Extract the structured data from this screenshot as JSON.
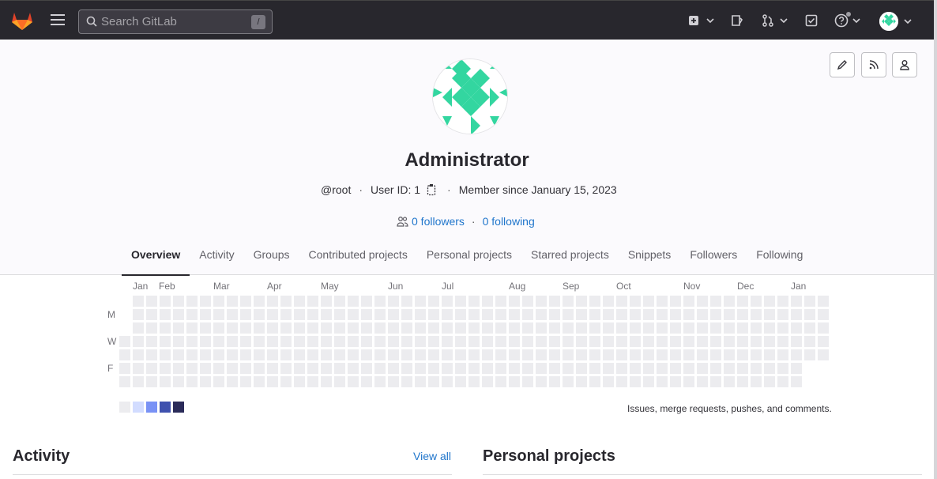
{
  "topbar": {
    "search_placeholder": "Search GitLab",
    "search_shortcut": "/"
  },
  "profile": {
    "name": "Administrator",
    "username": "@root",
    "user_id": "User ID: 1",
    "member_since": "Member since January 15, 2023",
    "followers": "0 followers",
    "following": "0 following"
  },
  "tabs": [
    "Overview",
    "Activity",
    "Groups",
    "Contributed projects",
    "Personal projects",
    "Starred projects",
    "Snippets",
    "Followers",
    "Following"
  ],
  "calendar": {
    "months": [
      "Jan",
      "Feb",
      "Mar",
      "Apr",
      "May",
      "Jun",
      "Jul",
      "Aug",
      "Sep",
      "Oct",
      "Nov",
      "Dec",
      "Jan"
    ],
    "day_labels": [
      "M",
      "W",
      "F"
    ],
    "legend_colors": [
      "#ececef",
      "#d2dcff",
      "#7992f5",
      "#3f51ae",
      "#2a2b59"
    ],
    "legend_text": "Issues, merge requests, pushes, and comments."
  },
  "activity": {
    "title": "Activity",
    "view_all": "View all"
  },
  "personal_projects": {
    "title": "Personal projects"
  }
}
